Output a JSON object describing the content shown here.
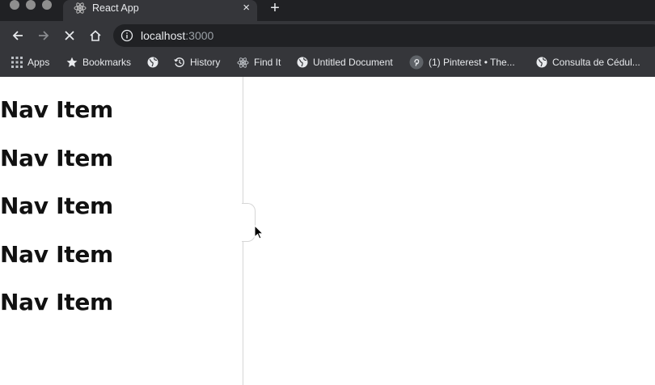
{
  "browser": {
    "tab": {
      "title": "React App",
      "close_glyph": "×",
      "favicon": "react-icon"
    },
    "new_tab_glyph": "+",
    "address": {
      "host": "localhost",
      "port": ":3000",
      "info_icon": "info-icon"
    },
    "controls": [
      "back-arrow-icon",
      "forward-arrow-icon",
      "stop-icon",
      "home-icon"
    ],
    "bookmarks": [
      {
        "label": "Apps",
        "icon": "apps-grid-icon"
      },
      {
        "label": "Bookmarks",
        "icon": "star-icon"
      },
      {
        "label": "",
        "icon": "globe-icon"
      },
      {
        "label": "History",
        "icon": "history-icon"
      },
      {
        "label": "Find It",
        "icon": "react-icon"
      },
      {
        "label": "Untitled Document",
        "icon": "globe-icon"
      },
      {
        "label": "(1) Pinterest • The...",
        "icon": "pinterest-icon"
      },
      {
        "label": "Consulta de Cédul...",
        "icon": "globe-icon"
      }
    ]
  },
  "sidebar": {
    "items": [
      {
        "label": "Nav Item"
      },
      {
        "label": "Nav Item"
      },
      {
        "label": "Nav Item"
      },
      {
        "label": "Nav Item"
      },
      {
        "label": "Nav Item"
      }
    ]
  },
  "colors": {
    "chrome_dark": "#202124",
    "chrome": "#35363a",
    "chrome_text": "#e8eaed",
    "page_bg": "#ffffff",
    "nav_text": "#111111",
    "divider": "#d6d6d6"
  }
}
